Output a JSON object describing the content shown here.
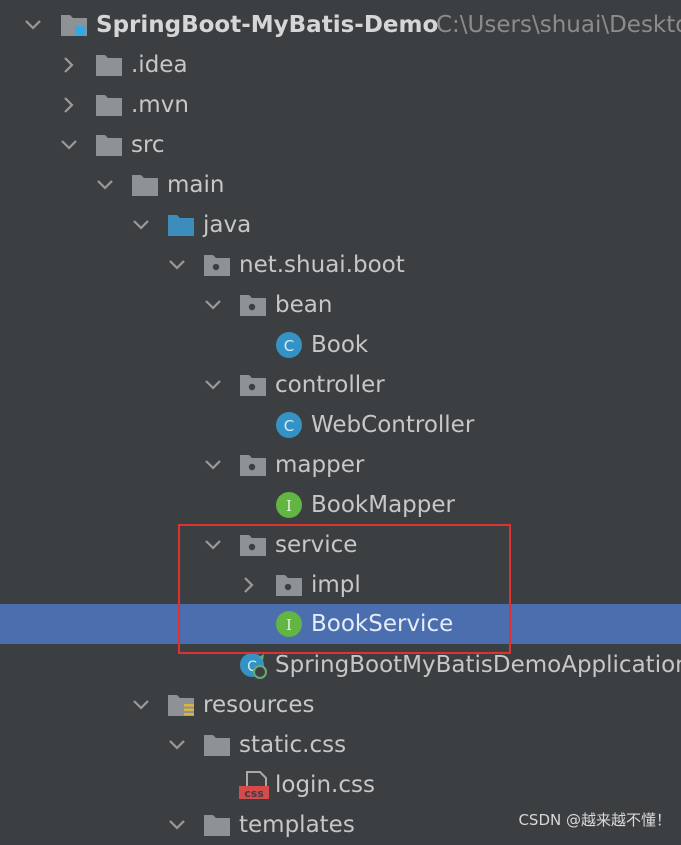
{
  "project": {
    "name": "SpringBoot-MyBatis-Demo",
    "path": "C:\\Users\\shuai\\Desktop"
  },
  "tree": [
    {
      "label": "SpringBoot-MyBatis-Demo",
      "icon": "project-folder-icon",
      "expanded": true
    },
    {
      "label": ".idea",
      "icon": "folder-icon",
      "expanded": false
    },
    {
      "label": ".mvn",
      "icon": "folder-icon",
      "expanded": false
    },
    {
      "label": "src",
      "icon": "folder-icon",
      "expanded": true
    },
    {
      "label": "main",
      "icon": "folder-icon",
      "expanded": true
    },
    {
      "label": "java",
      "icon": "source-folder-icon",
      "expanded": true
    },
    {
      "label": "net.shuai.boot",
      "icon": "package-icon",
      "expanded": true
    },
    {
      "label": "bean",
      "icon": "package-icon",
      "expanded": true
    },
    {
      "label": "Book",
      "icon": "class-icon",
      "badge": "C"
    },
    {
      "label": "controller",
      "icon": "package-icon",
      "expanded": true
    },
    {
      "label": "WebController",
      "icon": "class-icon",
      "badge": "C"
    },
    {
      "label": "mapper",
      "icon": "package-icon",
      "expanded": true
    },
    {
      "label": "BookMapper",
      "icon": "interface-icon",
      "badge": "I"
    },
    {
      "label": "service",
      "icon": "package-icon",
      "expanded": true
    },
    {
      "label": "impl",
      "icon": "package-icon",
      "expanded": false
    },
    {
      "label": "BookService",
      "icon": "interface-icon",
      "badge": "I",
      "selected": true
    },
    {
      "label": "SpringBootMyBatisDemoApplication",
      "icon": "spring-boot-app-icon"
    },
    {
      "label": "resources",
      "icon": "resources-folder-icon",
      "expanded": true
    },
    {
      "label": "static.css",
      "icon": "folder-icon",
      "expanded": true
    },
    {
      "label": "login.css",
      "icon": "css-file-icon",
      "badge": "css"
    },
    {
      "label": "templates",
      "icon": "folder-icon",
      "expanded": true
    }
  ],
  "watermark": "CSDN @越来越不懂！",
  "colors": {
    "background": "#3c3f41",
    "selection": "#4b6eaf",
    "highlight_box": "#e03131",
    "class_badge": "#3592c4",
    "interface_badge": "#62b543"
  }
}
